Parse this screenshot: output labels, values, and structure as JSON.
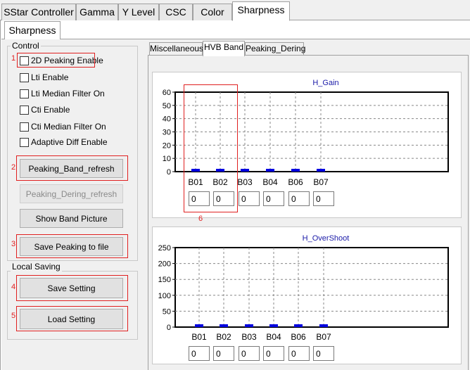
{
  "top_tabs": [
    "SStar Controller",
    "Gamma",
    "Y Level",
    "CSC",
    "Color",
    "Sharpness"
  ],
  "sub_tab": "Sharpness",
  "control": {
    "title": "Control",
    "checkboxes": [
      "2D Peaking Enable",
      "Lti Enable",
      "Lti Median Filter On",
      "Cti Enable",
      "Cti Median Filter On",
      "Adaptive Diff Enable"
    ],
    "peaking_band_refresh": "Peaking_Band_refresh",
    "peaking_dering_refresh": "Peaking_Dering_refresh",
    "show_band_picture": "Show Band Picture",
    "save_peaking": "Save Peaking to file"
  },
  "local_saving": {
    "title": "Local Saving",
    "save_setting": "Save Setting",
    "load_setting": "Load Setting"
  },
  "annotations": [
    "1",
    "2",
    "3",
    "4",
    "5",
    "6"
  ],
  "inner_tabs": [
    "Miscellaneous",
    "HVB Band",
    "Peaking_Dering"
  ],
  "colors": {
    "bar": "#0000e0",
    "title": "#1a1aa8",
    "annotation": "#e02020"
  },
  "chart_data": [
    {
      "type": "bar",
      "title": "H_Gain",
      "categories": [
        "B01",
        "B02",
        "B03",
        "B04",
        "B06",
        "B07"
      ],
      "values": [
        0,
        0,
        0,
        0,
        0,
        0
      ],
      "ylim": [
        0,
        60
      ],
      "yticks": [
        "0",
        "10",
        "20",
        "30",
        "40",
        "50",
        "60"
      ],
      "grid": true,
      "inputs": [
        "0",
        "0",
        "0",
        "0",
        "0",
        "0"
      ]
    },
    {
      "type": "bar",
      "title": "H_OverShoot",
      "categories": [
        "B01",
        "B02",
        "B03",
        "B04",
        "B06",
        "B07"
      ],
      "values": [
        0,
        0,
        0,
        0,
        0,
        0
      ],
      "ylim": [
        0,
        250
      ],
      "yticks": [
        "0",
        "50",
        "100",
        "150",
        "200",
        "250"
      ],
      "grid": true,
      "inputs": [
        "0",
        "0",
        "0",
        "0",
        "0",
        "0"
      ]
    }
  ]
}
